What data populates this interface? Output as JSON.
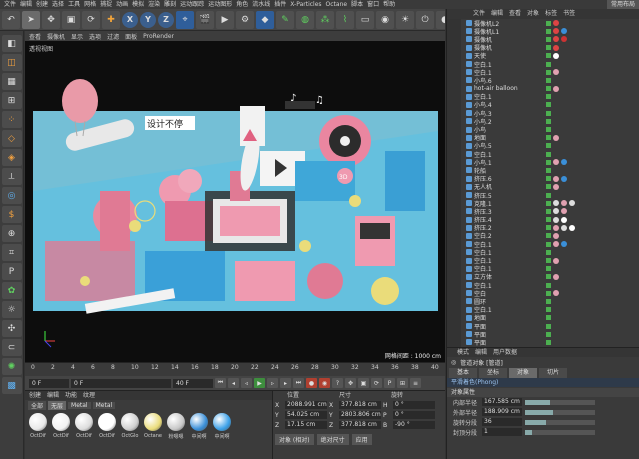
{
  "menubar": {
    "items": [
      "文件",
      "编辑",
      "创建",
      "选择",
      "工具",
      "网格",
      "捕捉",
      "动画",
      "模拟",
      "渲染",
      "雕刻",
      "运动跟踪",
      "运动图形",
      "角色",
      "流水线",
      "插件",
      "X-Particles",
      "Octane",
      "脚本",
      "窗口",
      "帮助"
    ],
    "layout_label": "常用布局"
  },
  "toolbar": {
    "axis_x": "X",
    "axis_y": "Y",
    "axis_z": "Z"
  },
  "viewport": {
    "menu": [
      "查看",
      "摄像机",
      "显示",
      "选项",
      "过滤",
      "面板",
      "ProRender"
    ],
    "title": "透视视图",
    "grid_label": "网格间距 : 1000 cm",
    "scene_text": "设计不停",
    "billboard_text": "3D"
  },
  "timeline": {
    "ticks": [
      "0",
      "2",
      "4",
      "6",
      "8",
      "10",
      "12",
      "14",
      "16",
      "18",
      "20",
      "22",
      "24",
      "26",
      "28",
      "30",
      "32",
      "34",
      "36",
      "38",
      "40"
    ],
    "start_frame": "0 F",
    "current_frame": "0 F",
    "end_frame": "40 F",
    "end_frame2": "40 F"
  },
  "materials": {
    "tabs": [
      "创建",
      "编辑",
      "功能",
      "纹理"
    ],
    "filters": [
      "全部",
      "无层",
      "Metal",
      "Metal"
    ],
    "items": [
      {
        "name": "OctDif",
        "color": "#e8e8e8"
      },
      {
        "name": "OctDif",
        "color": "#f2f2f2"
      },
      {
        "name": "OctDif",
        "color": "#dddddd"
      },
      {
        "name": "OctDif",
        "color": "#ffffff"
      },
      {
        "name": "OctGlo",
        "color": "#cfcfcf"
      },
      {
        "name": "Octane",
        "color": "#eadc7a"
      },
      {
        "name": "粉嗯嗯",
        "color": "#c8c8c8"
      },
      {
        "name": "中间啊",
        "color": "#3a8fd8"
      },
      {
        "name": "中间啊",
        "color": "#3aa0e8"
      }
    ]
  },
  "coords": {
    "headers": [
      "位置",
      "尺寸",
      "旋转"
    ],
    "rows": [
      {
        "axis": "X",
        "pos": "2088.991 cm",
        "size": "377.818 cm",
        "rot_label": "H",
        "rot": "0 °"
      },
      {
        "axis": "Y",
        "pos": "54.025 cm",
        "size": "2803.806 cm",
        "rot_label": "P",
        "rot": "0 °"
      },
      {
        "axis": "Z",
        "pos": "17.15 cm",
        "size": "377.818 cm",
        "rot_label": "B",
        "rot": "-90 °"
      }
    ],
    "mode1": "对象 (相对)",
    "mode2": "绝对尺寸",
    "apply": "应用"
  },
  "objects": {
    "tabs": [
      "文件",
      "编辑",
      "查看",
      "对象",
      "标签",
      "书签"
    ],
    "rows": [
      {
        "name": "摄像机L2",
        "tags": [
          "#d44"
        ]
      },
      {
        "name": "摄像机L1",
        "tags": [
          "#d44",
          "#3a8fd8"
        ]
      },
      {
        "name": "摄像机",
        "tags": [
          "#d44",
          "#c33"
        ]
      },
      {
        "name": "摄像机",
        "tags": [
          "#d44"
        ]
      },
      {
        "name": "天使",
        "tags": [
          "#ffffff"
        ]
      },
      {
        "name": "空白.1",
        "tags": []
      },
      {
        "name": "空白.1",
        "tags": [
          "#e0a0b0"
        ]
      },
      {
        "name": "小鸟.6",
        "tags": []
      },
      {
        "name": "hot-air balloon",
        "tags": [
          "#e0a0b0"
        ]
      },
      {
        "name": "空白.1",
        "tags": []
      },
      {
        "name": "小鸟.4",
        "tags": []
      },
      {
        "name": "小鸟.3",
        "tags": []
      },
      {
        "name": "小鸟.2",
        "tags": []
      },
      {
        "name": "小鸟",
        "tags": []
      },
      {
        "name": "地面",
        "tags": [
          "#e0a0b0"
        ]
      },
      {
        "name": "小鸟.5",
        "tags": []
      },
      {
        "name": "空白.1",
        "tags": []
      },
      {
        "name": "小鸟.1",
        "tags": [
          "#e0a0b0",
          "#3a8fd8"
        ]
      },
      {
        "name": "轮船",
        "tags": []
      },
      {
        "name": "挤压.6",
        "tags": [
          "#e0a0b0",
          "#3a8fd8"
        ]
      },
      {
        "name": "无人机",
        "tags": [
          "#e0a0b0"
        ]
      },
      {
        "name": "挤压.5",
        "tags": []
      },
      {
        "name": "克隆.1",
        "tags": [
          "#dddddd",
          "#e0a0b0",
          "#dddddd"
        ]
      },
      {
        "name": "挤压.3",
        "tags": [
          "#dddddd",
          "#e0a0b0"
        ]
      },
      {
        "name": "挤压.4",
        "tags": [
          "#dddddd",
          "#ffffff"
        ]
      },
      {
        "name": "挤压.2",
        "tags": [
          "#e0a0b0",
          "#dddddd",
          "#ffffff"
        ]
      },
      {
        "name": "空白.2",
        "tags": [
          "#e0a0b0"
        ]
      },
      {
        "name": "空白.1",
        "tags": [
          "#e0a0b0",
          "#3a8fd8"
        ]
      },
      {
        "name": "空白.1",
        "tags": []
      },
      {
        "name": "空白.1",
        "tags": [
          "#e0a0b0"
        ]
      },
      {
        "name": "空白.1",
        "tags": []
      },
      {
        "name": "立方体",
        "tags": [
          "#e0a0b0"
        ]
      },
      {
        "name": "空白.1",
        "tags": []
      },
      {
        "name": "空白",
        "tags": [
          "#e0a0b0"
        ]
      },
      {
        "name": "圆环",
        "tags": []
      },
      {
        "name": "空白.1",
        "tags": []
      },
      {
        "name": "地面",
        "tags": []
      },
      {
        "name": "平面",
        "tags": []
      },
      {
        "name": "平面",
        "tags": []
      },
      {
        "name": "平面",
        "tags": []
      }
    ]
  },
  "attributes": {
    "menu": [
      "模式",
      "编辑",
      "用户数据"
    ],
    "title": "管道对象 [管道]",
    "tabs": [
      "基本",
      "坐标",
      "对象",
      "切片"
    ],
    "selected_tab": "对象",
    "subtitle": "平滑着色(Phong)",
    "section": "对象属性",
    "fields": [
      {
        "label": "内部半径",
        "value": "167.585 cm",
        "fill": 0.35
      },
      {
        "label": "外部半径",
        "value": "188.909 cm",
        "fill": 0.4
      },
      {
        "label": "旋转分段",
        "value": "36",
        "fill": 0.3
      },
      {
        "label": "封顶分段",
        "value": "1",
        "fill": 0.1
      }
    ]
  }
}
